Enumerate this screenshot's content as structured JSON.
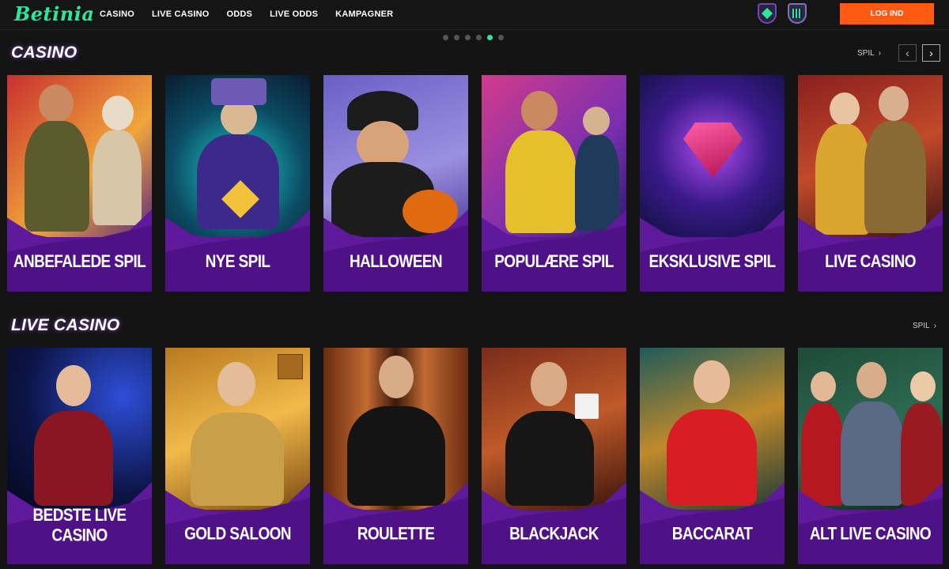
{
  "header": {
    "logo": "Betinia",
    "nav": [
      "CASINO",
      "LIVE CASINO",
      "ODDS",
      "LIVE ODDS",
      "KAMPAGNER"
    ],
    "login_label": "LOG IND"
  },
  "carousel": {
    "dots": 6,
    "active_index": 4
  },
  "sections": [
    {
      "title": "CASINO",
      "link_label": "SPIL",
      "has_arrows": true,
      "cards": [
        {
          "label": "ANBEFALEDE SPIL"
        },
        {
          "label": "NYE SPIL"
        },
        {
          "label": "HALLOWEEN"
        },
        {
          "label": "POPULÆRE SPIL"
        },
        {
          "label": "EKSKLUSIVE SPIL"
        },
        {
          "label": "LIVE CASINO"
        }
      ]
    },
    {
      "title": "LIVE CASINO",
      "link_label": "SPIL",
      "has_arrows": false,
      "cards": [
        {
          "label": "BEDSTE LIVE CASINO"
        },
        {
          "label": "GOLD SALOON"
        },
        {
          "label": "ROULETTE"
        },
        {
          "label": "BLACKJACK"
        },
        {
          "label": "BACCARAT"
        },
        {
          "label": "ALT LIVE CASINO"
        }
      ]
    }
  ],
  "colors": {
    "brand_green": "#2ee59d",
    "login_orange": "#ff5a13",
    "card_purple": "#5e1a9a",
    "background": "#141414"
  }
}
